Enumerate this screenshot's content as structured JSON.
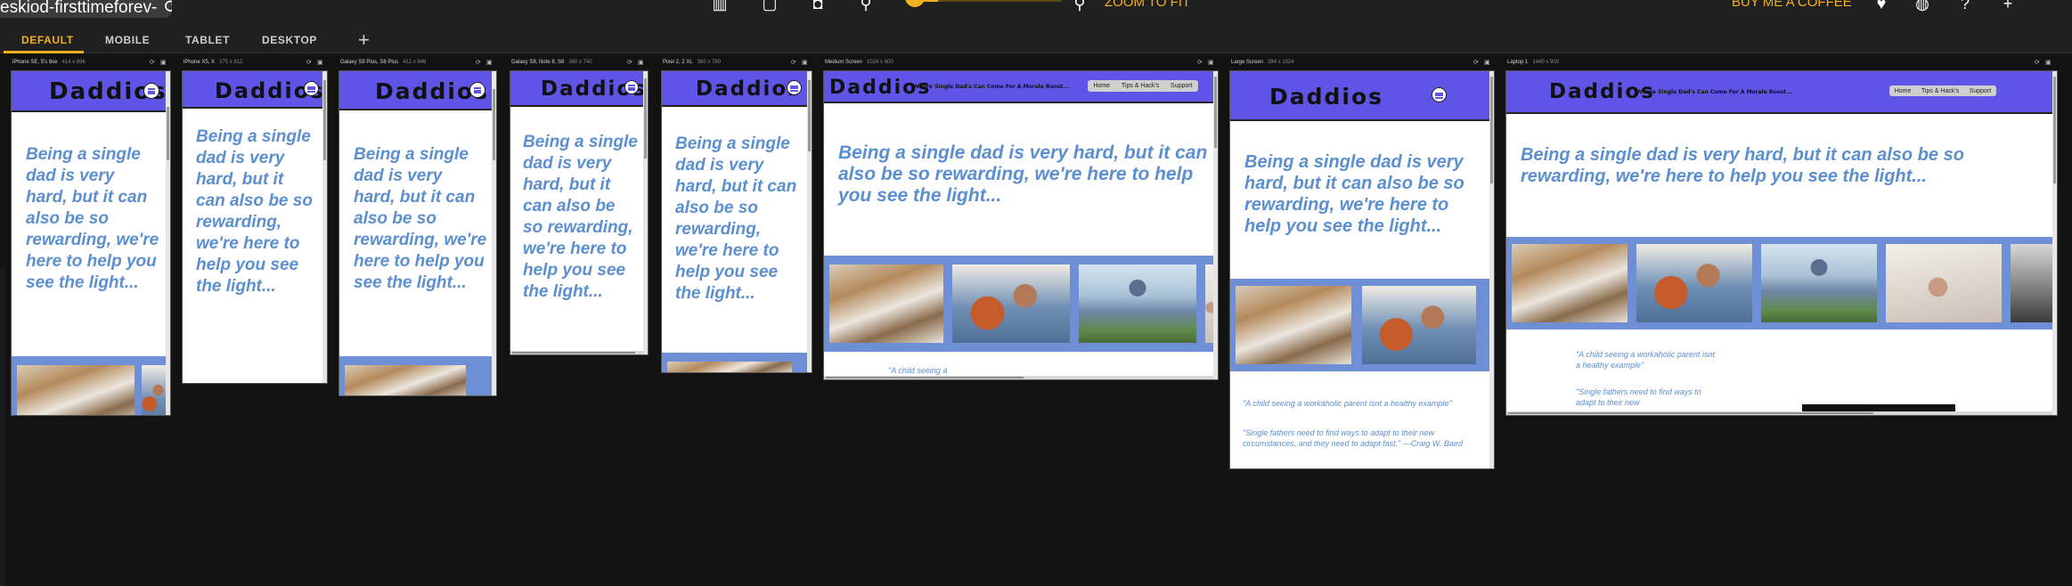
{
  "toolbar": {
    "url_text": "eskiod-firsttimeforev-",
    "reload_glyph": "⟳",
    "zoom_label": "ZOOM TO FIT",
    "zoom_level": 0.18,
    "coffee_label": "BUY ME A COFFEE",
    "icons": {
      "layout": "▥",
      "screenshot": "▢",
      "record": "◘",
      "zoom_out": "⚲",
      "zoom_in": "⚲",
      "twitter": "♥",
      "github": "◍",
      "help": "?",
      "more": "+"
    }
  },
  "tabs": {
    "default": "DEFAULT",
    "mobile": "MOBILE",
    "tablet": "TABLET",
    "desktop": "DESKTOP",
    "add": "+"
  },
  "site": {
    "logo": "Daddios",
    "tagline": "Where Single Dad's Can Come For A Morale Boost...",
    "nav": [
      "Home",
      "Tips & Hack's",
      "Support"
    ],
    "hero": "Being a single dad is very hard, but it can also be so rewarding, we're here to help you see the light...",
    "quote_1": "\"A child seeing a workaholic parent isnt a healthy example\"",
    "quote_2": "\"Single fathers need to find ways to adapt to their new circumstances, and they need to adapt fast.\" —Craig W. Baird",
    "quote_1_short": "\"A child seeing a",
    "quote_1_mid": "\"A child seeing a workaholic parent isnt a healthy example\"",
    "quote_2_short": "\"Single fathers need to find ways to adapt to their new"
  },
  "devices": [
    {
      "name": "iPhone SE, 5's 8se",
      "dims": "414 x 896"
    },
    {
      "name": "iPhone X5, X",
      "dims": "375 x 812"
    },
    {
      "name": "Galaxy S9 Plus, S8 Plus",
      "dims": "412 x 846"
    },
    {
      "name": "Galaxy S8, Note 8, S8",
      "dims": "360 x 740"
    },
    {
      "name": "Pixel 2, 2 XL",
      "dims": "360 x 780"
    },
    {
      "name": "Medium Screen",
      "dims": "1024 x 800"
    },
    {
      "name": "Large Screen",
      "dims": "384 x 1024"
    },
    {
      "name": "Laptop 1",
      "dims": "1440 x 900"
    }
  ]
}
